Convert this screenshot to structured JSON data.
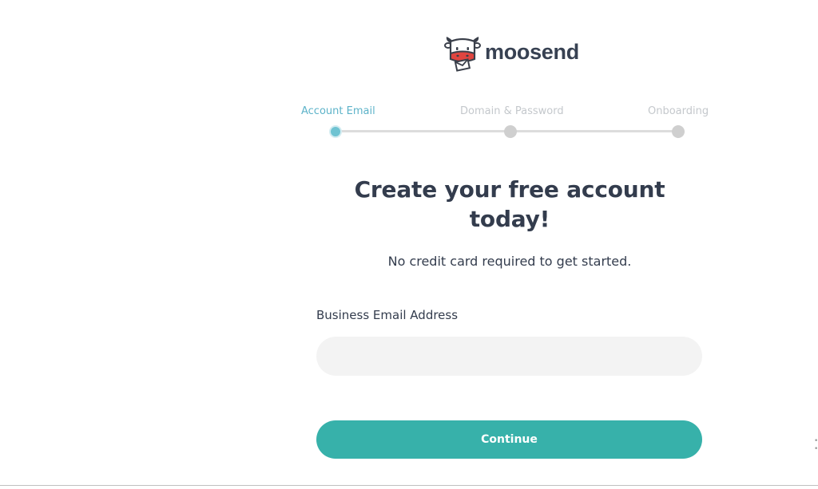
{
  "brand": {
    "name": "moosend",
    "logo_icon": "cow-mascot-icon",
    "text_color": "#374152"
  },
  "stepper": {
    "steps": [
      {
        "label": "Account Email",
        "state": "active"
      },
      {
        "label": "Domain & Password",
        "state": "inactive"
      },
      {
        "label": "Onboarding",
        "state": "inactive"
      }
    ],
    "active_color": "#5db3c9",
    "inactive_color": "#c4c8cc"
  },
  "signup": {
    "title": "Create your free account today!",
    "subtitle": "No credit card required to get started.",
    "email_label": "Business Email Address",
    "email_value": "",
    "email_placeholder": "",
    "continue_label": "Continue",
    "button_color": "#37b1aa"
  }
}
